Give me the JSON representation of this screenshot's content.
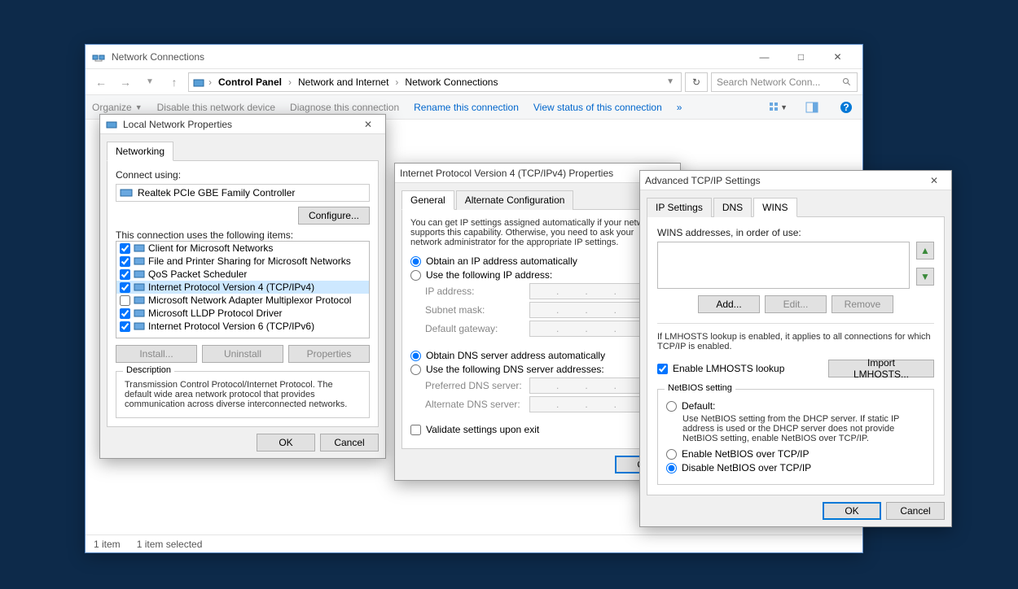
{
  "explorer": {
    "title": "Network Connections",
    "breadcrumbs": [
      "Control Panel",
      "Network and Internet",
      "Network Connections"
    ],
    "search_placeholder": "Search Network Conn...",
    "toolbar": {
      "organize": "Organize",
      "disable": "Disable this network device",
      "diagnose": "Diagnose this connection",
      "rename": "Rename this connection",
      "viewstatus": "View status of this connection"
    },
    "status": {
      "items": "1 item",
      "selected": "1 item selected"
    }
  },
  "props": {
    "title": "Local Network Properties",
    "tab": "Networking",
    "connect_using": "Connect using:",
    "adapter": "Realtek PCIe GBE Family Controller",
    "configure": "Configure...",
    "uses_items": "This connection uses the following items:",
    "items": [
      {
        "checked": true,
        "label": "Client for Microsoft Networks"
      },
      {
        "checked": true,
        "label": "File and Printer Sharing for Microsoft Networks"
      },
      {
        "checked": true,
        "label": "QoS Packet Scheduler"
      },
      {
        "checked": true,
        "label": "Internet Protocol Version 4 (TCP/IPv4)",
        "selected": true
      },
      {
        "checked": false,
        "label": "Microsoft Network Adapter Multiplexor Protocol"
      },
      {
        "checked": true,
        "label": "Microsoft LLDP Protocol Driver"
      },
      {
        "checked": true,
        "label": "Internet Protocol Version 6 (TCP/IPv6)"
      }
    ],
    "install": "Install...",
    "uninstall": "Uninstall",
    "properties": "Properties",
    "desc_hdr": "Description",
    "desc": "Transmission Control Protocol/Internet Protocol. The default wide area network protocol that provides communication across diverse interconnected networks.",
    "ok": "OK",
    "cancel": "Cancel"
  },
  "ipv4": {
    "title": "Internet Protocol Version 4 (TCP/IPv4) Properties",
    "tabs": [
      "General",
      "Alternate Configuration"
    ],
    "blurb": "You can get IP settings assigned automatically if your network supports this capability. Otherwise, you need to ask your network administrator for the appropriate IP settings.",
    "obtain_auto": "Obtain an IP address automatically",
    "use_following": "Use the following IP address:",
    "ip_address": "IP address:",
    "subnet": "Subnet mask:",
    "gateway": "Default gateway:",
    "dns_auto": "Obtain DNS server address automatically",
    "dns_use": "Use the following DNS server addresses:",
    "pref_dns": "Preferred DNS server:",
    "alt_dns": "Alternate DNS server:",
    "validate": "Validate settings upon exit",
    "ok": "OK"
  },
  "adv": {
    "title": "Advanced TCP/IP Settings",
    "tabs": [
      "IP Settings",
      "DNS",
      "WINS"
    ],
    "wins_label": "WINS addresses, in order of use:",
    "add": "Add...",
    "edit": "Edit...",
    "remove": "Remove",
    "lmhosts_note": "If LMHOSTS lookup is enabled, it applies to all connections for which TCP/IP is enabled.",
    "enable_lmhosts": "Enable LMHOSTS lookup",
    "import_lmhosts": "Import LMHOSTS...",
    "netbios_legend": "NetBIOS setting",
    "nb_default": "Default:",
    "nb_default_desc": "Use NetBIOS setting from the DHCP server. If static IP address is used or the DHCP server does not provide NetBIOS setting, enable NetBIOS over TCP/IP.",
    "nb_enable": "Enable NetBIOS over TCP/IP",
    "nb_disable": "Disable NetBIOS over TCP/IP",
    "ok": "OK",
    "cancel": "Cancel"
  }
}
